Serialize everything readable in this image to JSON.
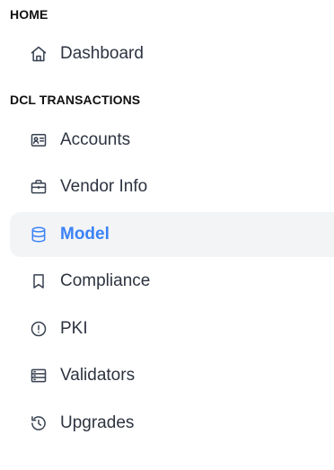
{
  "sidebar": {
    "sections": [
      {
        "heading": "HOME",
        "items": [
          {
            "label": "Dashboard",
            "icon": "home-icon",
            "active": false
          }
        ]
      },
      {
        "heading": "DCL TRANSACTIONS",
        "items": [
          {
            "label": "Accounts",
            "icon": "id-card-icon",
            "active": false
          },
          {
            "label": "Vendor Info",
            "icon": "briefcase-icon",
            "active": false
          },
          {
            "label": "Model",
            "icon": "database-icon",
            "active": true
          },
          {
            "label": "Compliance",
            "icon": "bookmark-icon",
            "active": false
          },
          {
            "label": "PKI",
            "icon": "alert-circle-icon",
            "active": false
          },
          {
            "label": "Validators",
            "icon": "server-icon",
            "active": false
          },
          {
            "label": "Upgrades",
            "icon": "history-icon",
            "active": false
          }
        ]
      }
    ]
  },
  "colors": {
    "accent": "#3b82f6",
    "active_background": "#f3f4f6",
    "text": "#2d3340",
    "heading": "#111111"
  }
}
